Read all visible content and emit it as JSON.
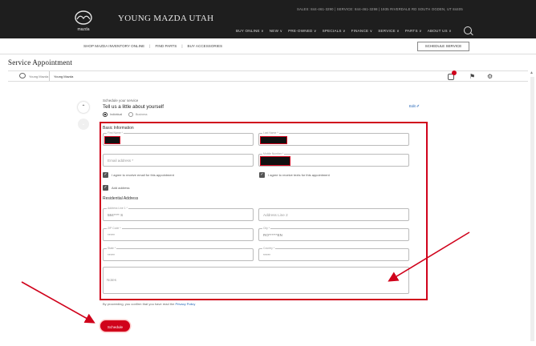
{
  "header": {
    "dealer_name": "YOUNG MAZDA UTAH",
    "contact": "SALES: 844-461-3290  |  SERVICE: 844-461-3298  |  1935 RIVERDALE RD SOUTH OGDEN, UT 84405",
    "nav": [
      "BUY ONLINE ∨",
      "NEW ∨",
      "PRE-OWNED ∨",
      "SPECIALS ∨",
      "FINANCE ∨",
      "SERVICE ∨",
      "PARTS ∨",
      "ABOUT US ∨"
    ],
    "logo_text": "mazda"
  },
  "subnav": {
    "items": [
      "SHOP MAZDA INVENTORY ONLINE",
      "FIND PARTS",
      "BUY ACCESSORIES"
    ],
    "schedule_button": "SCHEDULE SERVICE"
  },
  "page_title": "Service Appointment",
  "app_bar": {
    "brand": "Young Mazda",
    "dealer": "Young Mazda"
  },
  "form": {
    "schedule_hint": "Schedule your service",
    "heading": "Tell us a little about yourself",
    "edit_label": "Edit ✐",
    "radio_individual": "Individual",
    "radio_business": "Business",
    "basic_info": "Basic Information",
    "first_name_label": "First Name *",
    "last_name_label": "Last Name *",
    "email_placeholder": "Email address *",
    "mobile_label": "Mobile Number *",
    "email_consent": "I agree to receive email for this appointment",
    "text_consent": "I agree to receive texts for this appointment",
    "add_address": "Add address",
    "residential_address": "Residential Address",
    "address1_label": "Address Line 1 *",
    "address1_value": "584**** S",
    "address2_placeholder": "Address Line 2",
    "zip_label": "ZIP Code *",
    "zip_value": "*****",
    "city_label": "City *",
    "city_value": "RO******EN",
    "state_label": "State *",
    "state_value": "*****",
    "country_label": "Country *",
    "country_value": "*****",
    "notes_placeholder": "Notes",
    "consent_text": "By proceeding, you confirm that you have read the ",
    "privacy_link": "Privacy Policy",
    "schedule_button": "Schedule"
  },
  "colors": {
    "header_bg": "#1e1e1e",
    "accent_red": "#d0021b",
    "link_blue": "#1a5fb4"
  }
}
